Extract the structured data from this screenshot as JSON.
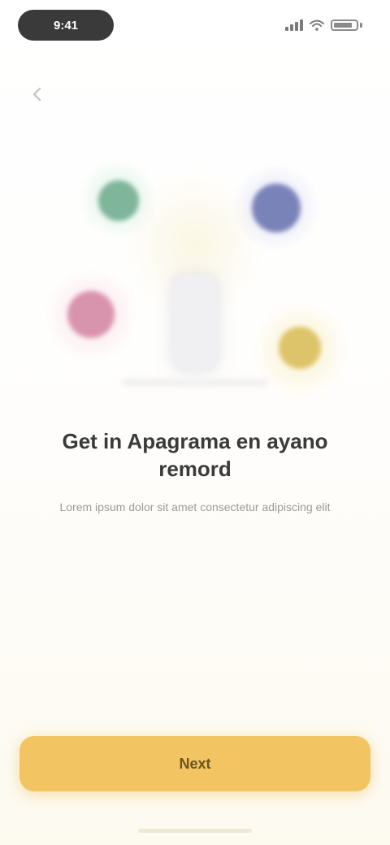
{
  "status_bar": {
    "time": "9:41"
  },
  "icons": {
    "back": "back-arrow-icon",
    "signal": "signal-icon",
    "wifi": "wifi-icon",
    "battery": "battery-icon"
  },
  "colors": {
    "accent": "#f2c462",
    "dot_green": "#7fb59a",
    "dot_blue": "#7a83b8",
    "dot_pink": "#d994ad",
    "dot_yellow": "#ddc46a"
  },
  "onboarding": {
    "headline": "Get in Apagrama en ayano remord",
    "subtitle": "Lorem ipsum dolor sit amet consectetur adipiscing elit"
  },
  "cta": {
    "label": "Next"
  }
}
